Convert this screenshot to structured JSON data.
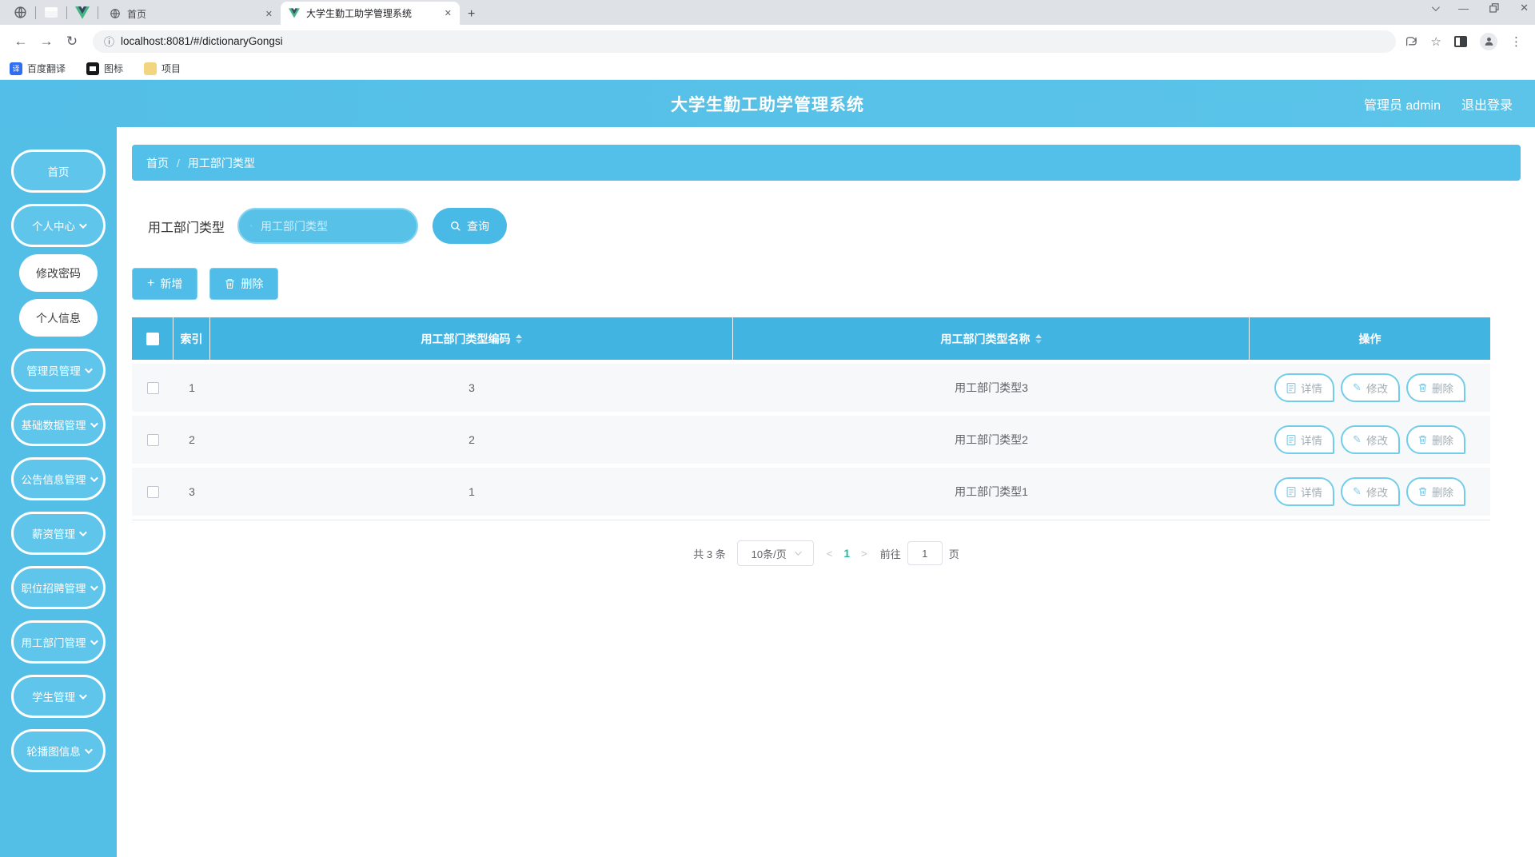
{
  "browser": {
    "tabs": [
      {
        "label": "首页"
      },
      {
        "label": "大学生勤工助学管理系统"
      }
    ],
    "close_glyph": "✕",
    "new_tab_glyph": "+",
    "url": "localhost:8081/#/dictionaryGongsi",
    "bookmarks": [
      {
        "label": "百度翻译",
        "icon_text": "译"
      },
      {
        "label": "图标"
      },
      {
        "label": "项目"
      }
    ]
  },
  "icons": {
    "back": "←",
    "forward": "→",
    "reload": "↻",
    "info": "ⓘ",
    "star": "☆",
    "kebab": "⋮",
    "minimize": "—",
    "close": "✕",
    "plus": "+",
    "pencil": "✎"
  },
  "header": {
    "title": "大学生勤工助学管理系统",
    "user": "管理员 admin",
    "logout": "退出登录"
  },
  "sidebar": {
    "items": [
      {
        "label": "首页"
      },
      {
        "label": "个人中心"
      },
      {
        "label": "修改密码"
      },
      {
        "label": "个人信息"
      },
      {
        "label": "管理员管理"
      },
      {
        "label": "基础数据管理"
      },
      {
        "label": "公告信息管理"
      },
      {
        "label": "薪资管理"
      },
      {
        "label": "职位招聘管理"
      },
      {
        "label": "用工部门管理"
      },
      {
        "label": "学生管理"
      },
      {
        "label": "轮播图信息"
      }
    ]
  },
  "breadcrumb": {
    "home": "首页",
    "separator": "/",
    "current": "用工部门类型"
  },
  "search": {
    "label": "用工部门类型",
    "placeholder": "用工部门类型",
    "query_label": "查询"
  },
  "toolbar_actions": {
    "add_label": "新增",
    "delete_label": "删除"
  },
  "table": {
    "headers": {
      "index": "索引",
      "code": "用工部门类型编码",
      "name": "用工部门类型名称",
      "actions": "操作"
    },
    "rows": [
      {
        "index": "1",
        "code": "3",
        "name": "用工部门类型3"
      },
      {
        "index": "2",
        "code": "2",
        "name": "用工部门类型2"
      },
      {
        "index": "3",
        "code": "1",
        "name": "用工部门类型1"
      }
    ],
    "row_actions": {
      "detail": "详情",
      "edit": "修改",
      "delete": "删除"
    }
  },
  "pagination": {
    "total": "共 3 条",
    "page_size": "10条/页",
    "prev": "<",
    "current_page": "1",
    "next": ">",
    "goto_prefix": "前往",
    "goto_value": "1",
    "goto_suffix": "页"
  },
  "colors": {
    "accent_blue": "#53bfe7",
    "table_header_blue": "#41b4e2",
    "active_page_teal": "#2eb89e"
  }
}
